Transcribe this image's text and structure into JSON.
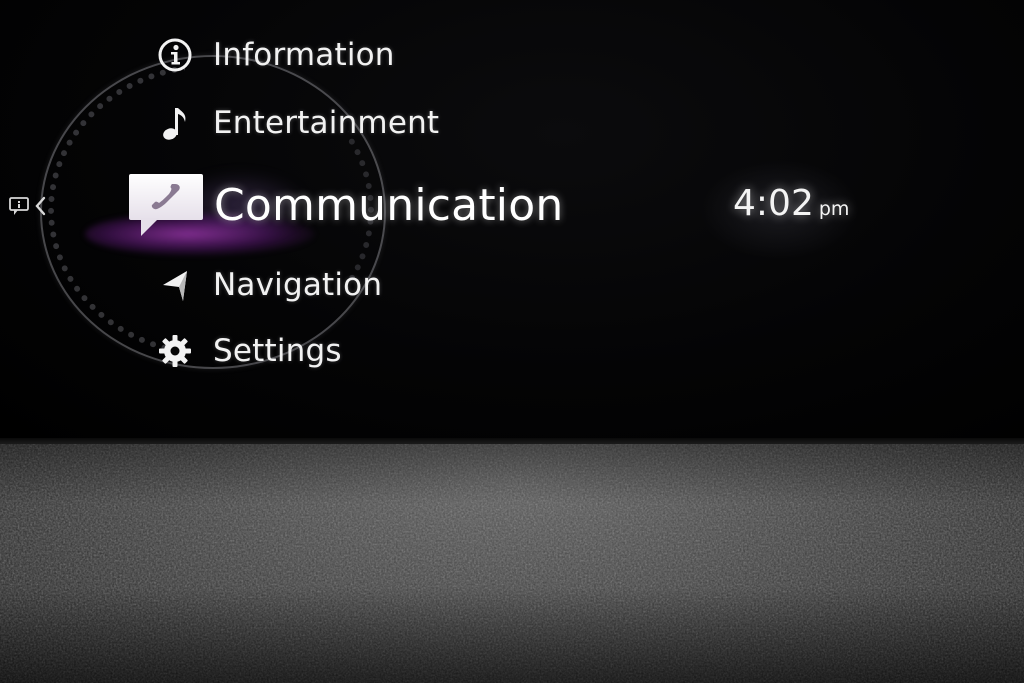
{
  "menu": {
    "items": [
      {
        "label": "Information",
        "icon": "info-icon",
        "selected": false
      },
      {
        "label": "Entertainment",
        "icon": "music-note-icon",
        "selected": false
      },
      {
        "label": "Communication",
        "icon": "phone-message-icon",
        "selected": true
      },
      {
        "label": "Navigation",
        "icon": "navigation-arrow-icon",
        "selected": false
      },
      {
        "label": "Settings",
        "icon": "gear-icon",
        "selected": false
      }
    ]
  },
  "notification": {
    "icon": "notification-message-icon",
    "arrow_icon": "chevron-left-icon"
  },
  "clock": {
    "time": "4:02",
    "ampm": "pm"
  },
  "colors": {
    "screen_background": "#000000",
    "text": "#f2f2f2",
    "selection_glow": "#aa3cbe",
    "dashboard": "#444444"
  }
}
